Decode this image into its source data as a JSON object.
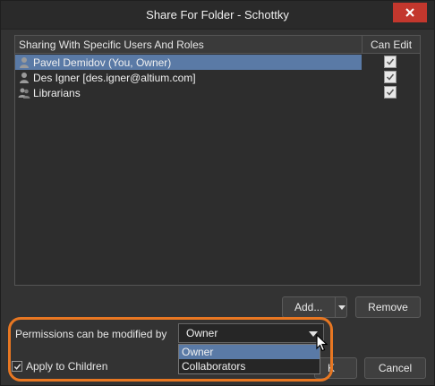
{
  "window": {
    "title": "Share For Folder - Schottky"
  },
  "table": {
    "columns": [
      "Sharing With Specific Users And Roles",
      "Can Edit"
    ],
    "rows": [
      {
        "name": "Pavel Demidov (You, Owner)",
        "icon": "user-icon",
        "can_edit": true,
        "selected": true
      },
      {
        "name": "Des Igner [des.igner@altium.com]",
        "icon": "user-icon",
        "can_edit": true,
        "selected": false
      },
      {
        "name": "Librarians",
        "icon": "group-icon",
        "can_edit": true,
        "selected": false
      }
    ]
  },
  "buttons": {
    "add": "Add...",
    "remove": "Remove",
    "ok_partial": "K",
    "cancel": "Cancel"
  },
  "permissions": {
    "label": "Permissions can be modified by",
    "selected": "Owner",
    "options": [
      "Owner",
      "Collaborators"
    ]
  },
  "apply_to_children": {
    "label": "Apply to Children",
    "checked": true
  },
  "colors": {
    "highlight": "#e87722",
    "selection": "#5a7aa6",
    "close": "#c3372d"
  }
}
